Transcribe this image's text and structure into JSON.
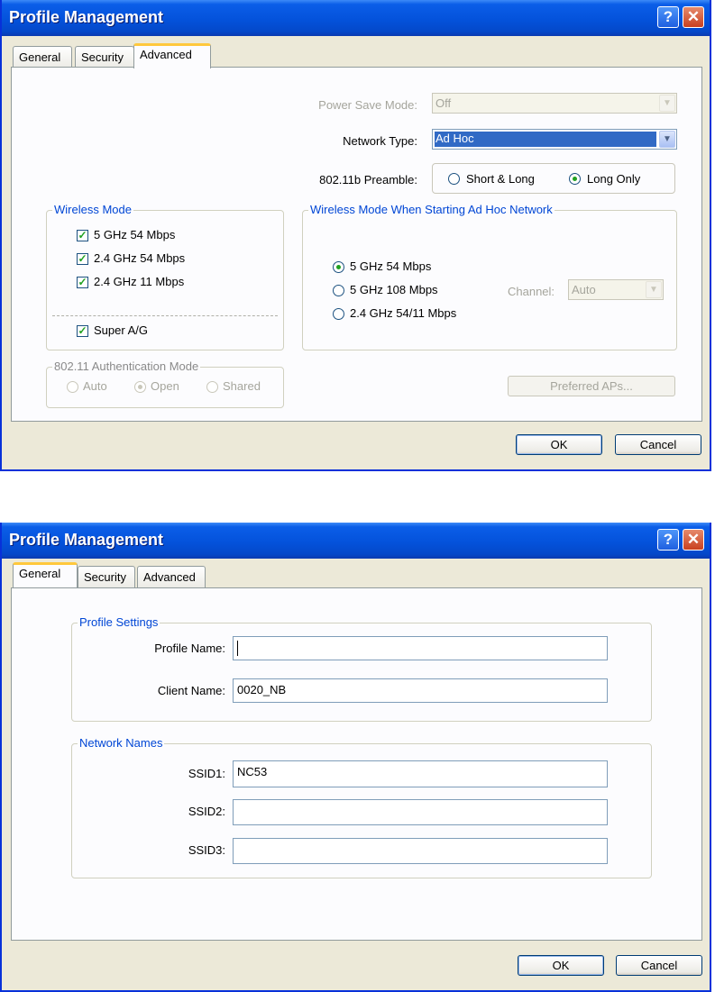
{
  "win1": {
    "title": "Profile Management",
    "help_glyph": "?",
    "close_glyph": "✕",
    "tabs": [
      "General",
      "Security",
      "Advanced"
    ],
    "active_tab": "Advanced",
    "power_save": {
      "label": "Power Save Mode:",
      "value": "Off"
    },
    "network_type": {
      "label": "Network Type:",
      "value": "Ad Hoc"
    },
    "preamble": {
      "label": "802.11b Preamble:",
      "options": [
        "Short & Long",
        "Long Only"
      ],
      "selected": "Long Only"
    },
    "wireless_mode": {
      "title": "Wireless Mode",
      "items": [
        {
          "label": "5 GHz 54 Mbps",
          "checked": true
        },
        {
          "label": "2.4 GHz 54 Mbps",
          "checked": true
        },
        {
          "label": "2.4 GHz 11 Mbps",
          "checked": true
        }
      ],
      "super": {
        "label": "Super A/G",
        "checked": true
      }
    },
    "adhoc": {
      "title": "Wireless Mode When Starting Ad Hoc Network",
      "options": [
        "5 GHz 54 Mbps",
        "5 GHz 108 Mbps",
        "2.4 GHz 54/11 Mbps"
      ],
      "selected": "5 GHz 54 Mbps",
      "channel_label": "Channel:",
      "channel_value": "Auto"
    },
    "auth": {
      "title": "802.11 Authentication Mode",
      "options": [
        "Auto",
        "Open",
        "Shared"
      ],
      "selected": "Open"
    },
    "preferred_aps_label": "Preferred APs...",
    "ok_label": "OK",
    "cancel_label": "Cancel",
    "check_glyph": "✓",
    "dropdown_glyph": "▼"
  },
  "win2": {
    "title": "Profile Management",
    "help_glyph": "?",
    "close_glyph": "✕",
    "tabs": [
      "General",
      "Security",
      "Advanced"
    ],
    "active_tab": "General",
    "profile_settings": {
      "title": "Profile Settings",
      "profile_name_label": "Profile Name:",
      "profile_name_value": "",
      "client_name_label": "Client Name:",
      "client_name_value": "0020_NB"
    },
    "network_names": {
      "title": "Network Names",
      "ssid1_label": "SSID1:",
      "ssid1_value": "NC53",
      "ssid2_label": "SSID2:",
      "ssid2_value": "",
      "ssid3_label": "SSID3:",
      "ssid3_value": ""
    },
    "ok_label": "OK",
    "cancel_label": "Cancel"
  }
}
